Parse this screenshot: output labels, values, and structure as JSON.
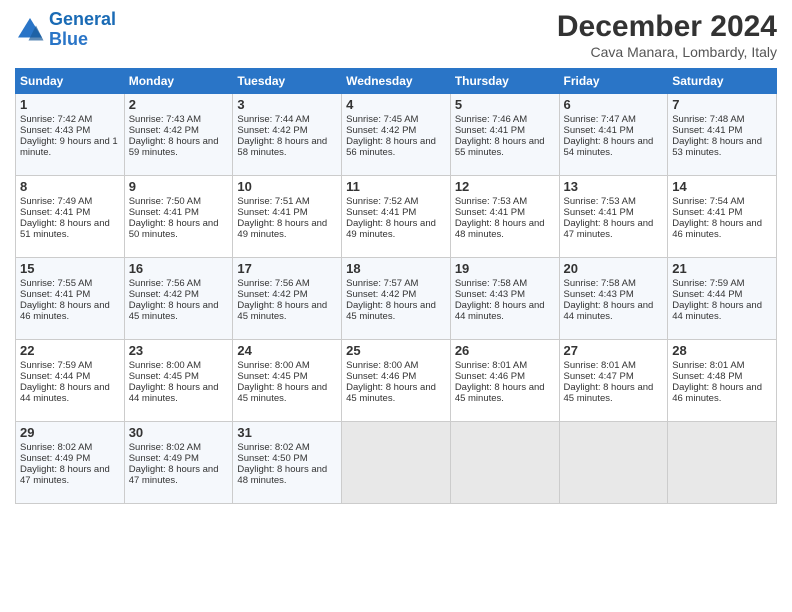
{
  "logo": {
    "line1": "General",
    "line2": "Blue"
  },
  "header": {
    "title": "December 2024",
    "location": "Cava Manara, Lombardy, Italy"
  },
  "days_of_week": [
    "Sunday",
    "Monday",
    "Tuesday",
    "Wednesday",
    "Thursday",
    "Friday",
    "Saturday"
  ],
  "weeks": [
    [
      {
        "day": "1",
        "sunrise": "Sunrise: 7:42 AM",
        "sunset": "Sunset: 4:43 PM",
        "daylight": "Daylight: 9 hours and 1 minute."
      },
      {
        "day": "2",
        "sunrise": "Sunrise: 7:43 AM",
        "sunset": "Sunset: 4:42 PM",
        "daylight": "Daylight: 8 hours and 59 minutes."
      },
      {
        "day": "3",
        "sunrise": "Sunrise: 7:44 AM",
        "sunset": "Sunset: 4:42 PM",
        "daylight": "Daylight: 8 hours and 58 minutes."
      },
      {
        "day": "4",
        "sunrise": "Sunrise: 7:45 AM",
        "sunset": "Sunset: 4:42 PM",
        "daylight": "Daylight: 8 hours and 56 minutes."
      },
      {
        "day": "5",
        "sunrise": "Sunrise: 7:46 AM",
        "sunset": "Sunset: 4:41 PM",
        "daylight": "Daylight: 8 hours and 55 minutes."
      },
      {
        "day": "6",
        "sunrise": "Sunrise: 7:47 AM",
        "sunset": "Sunset: 4:41 PM",
        "daylight": "Daylight: 8 hours and 54 minutes."
      },
      {
        "day": "7",
        "sunrise": "Sunrise: 7:48 AM",
        "sunset": "Sunset: 4:41 PM",
        "daylight": "Daylight: 8 hours and 53 minutes."
      }
    ],
    [
      {
        "day": "8",
        "sunrise": "Sunrise: 7:49 AM",
        "sunset": "Sunset: 4:41 PM",
        "daylight": "Daylight: 8 hours and 51 minutes."
      },
      {
        "day": "9",
        "sunrise": "Sunrise: 7:50 AM",
        "sunset": "Sunset: 4:41 PM",
        "daylight": "Daylight: 8 hours and 50 minutes."
      },
      {
        "day": "10",
        "sunrise": "Sunrise: 7:51 AM",
        "sunset": "Sunset: 4:41 PM",
        "daylight": "Daylight: 8 hours and 49 minutes."
      },
      {
        "day": "11",
        "sunrise": "Sunrise: 7:52 AM",
        "sunset": "Sunset: 4:41 PM",
        "daylight": "Daylight: 8 hours and 49 minutes."
      },
      {
        "day": "12",
        "sunrise": "Sunrise: 7:53 AM",
        "sunset": "Sunset: 4:41 PM",
        "daylight": "Daylight: 8 hours and 48 minutes."
      },
      {
        "day": "13",
        "sunrise": "Sunrise: 7:53 AM",
        "sunset": "Sunset: 4:41 PM",
        "daylight": "Daylight: 8 hours and 47 minutes."
      },
      {
        "day": "14",
        "sunrise": "Sunrise: 7:54 AM",
        "sunset": "Sunset: 4:41 PM",
        "daylight": "Daylight: 8 hours and 46 minutes."
      }
    ],
    [
      {
        "day": "15",
        "sunrise": "Sunrise: 7:55 AM",
        "sunset": "Sunset: 4:41 PM",
        "daylight": "Daylight: 8 hours and 46 minutes."
      },
      {
        "day": "16",
        "sunrise": "Sunrise: 7:56 AM",
        "sunset": "Sunset: 4:42 PM",
        "daylight": "Daylight: 8 hours and 45 minutes."
      },
      {
        "day": "17",
        "sunrise": "Sunrise: 7:56 AM",
        "sunset": "Sunset: 4:42 PM",
        "daylight": "Daylight: 8 hours and 45 minutes."
      },
      {
        "day": "18",
        "sunrise": "Sunrise: 7:57 AM",
        "sunset": "Sunset: 4:42 PM",
        "daylight": "Daylight: 8 hours and 45 minutes."
      },
      {
        "day": "19",
        "sunrise": "Sunrise: 7:58 AM",
        "sunset": "Sunset: 4:43 PM",
        "daylight": "Daylight: 8 hours and 44 minutes."
      },
      {
        "day": "20",
        "sunrise": "Sunrise: 7:58 AM",
        "sunset": "Sunset: 4:43 PM",
        "daylight": "Daylight: 8 hours and 44 minutes."
      },
      {
        "day": "21",
        "sunrise": "Sunrise: 7:59 AM",
        "sunset": "Sunset: 4:44 PM",
        "daylight": "Daylight: 8 hours and 44 minutes."
      }
    ],
    [
      {
        "day": "22",
        "sunrise": "Sunrise: 7:59 AM",
        "sunset": "Sunset: 4:44 PM",
        "daylight": "Daylight: 8 hours and 44 minutes."
      },
      {
        "day": "23",
        "sunrise": "Sunrise: 8:00 AM",
        "sunset": "Sunset: 4:45 PM",
        "daylight": "Daylight: 8 hours and 44 minutes."
      },
      {
        "day": "24",
        "sunrise": "Sunrise: 8:00 AM",
        "sunset": "Sunset: 4:45 PM",
        "daylight": "Daylight: 8 hours and 45 minutes."
      },
      {
        "day": "25",
        "sunrise": "Sunrise: 8:00 AM",
        "sunset": "Sunset: 4:46 PM",
        "daylight": "Daylight: 8 hours and 45 minutes."
      },
      {
        "day": "26",
        "sunrise": "Sunrise: 8:01 AM",
        "sunset": "Sunset: 4:46 PM",
        "daylight": "Daylight: 8 hours and 45 minutes."
      },
      {
        "day": "27",
        "sunrise": "Sunrise: 8:01 AM",
        "sunset": "Sunset: 4:47 PM",
        "daylight": "Daylight: 8 hours and 45 minutes."
      },
      {
        "day": "28",
        "sunrise": "Sunrise: 8:01 AM",
        "sunset": "Sunset: 4:48 PM",
        "daylight": "Daylight: 8 hours and 46 minutes."
      }
    ],
    [
      {
        "day": "29",
        "sunrise": "Sunrise: 8:02 AM",
        "sunset": "Sunset: 4:49 PM",
        "daylight": "Daylight: 8 hours and 47 minutes."
      },
      {
        "day": "30",
        "sunrise": "Sunrise: 8:02 AM",
        "sunset": "Sunset: 4:49 PM",
        "daylight": "Daylight: 8 hours and 47 minutes."
      },
      {
        "day": "31",
        "sunrise": "Sunrise: 8:02 AM",
        "sunset": "Sunset: 4:50 PM",
        "daylight": "Daylight: 8 hours and 48 minutes."
      },
      null,
      null,
      null,
      null
    ]
  ]
}
